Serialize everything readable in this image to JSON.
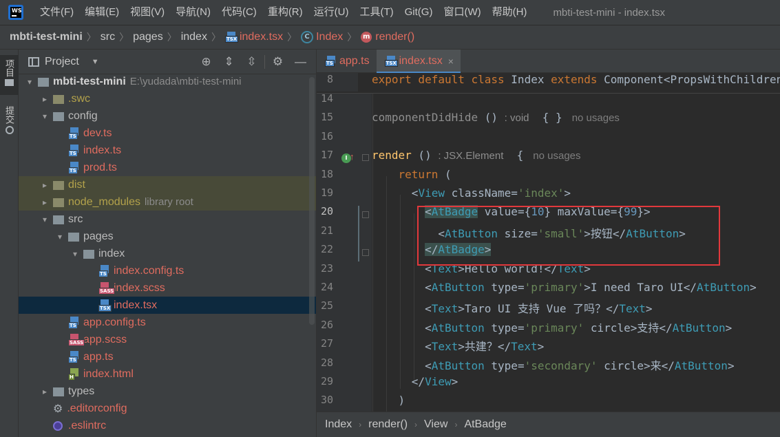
{
  "window": {
    "logo_text": "WS",
    "title": "mbti-test-mini - index.tsx"
  },
  "menu": [
    "文件(F)",
    "编辑(E)",
    "视图(V)",
    "导航(N)",
    "代码(C)",
    "重构(R)",
    "运行(U)",
    "工具(T)",
    "Git(G)",
    "窗口(W)",
    "帮助(H)"
  ],
  "breadcrumb": {
    "project": "mbti-test-mini",
    "parts": [
      "src",
      "pages",
      "index"
    ],
    "file": "index.tsx",
    "file_icon_label": "TSX",
    "class_icon": "C",
    "class": "Index",
    "method_icon": "m",
    "method": "render()"
  },
  "left_stripe": {
    "project_label": "项目",
    "commit_label": "提交"
  },
  "project_panel": {
    "title": "Project",
    "toolbar_icons": [
      "locate-icon",
      "expand-all-icon",
      "collapse-all-icon",
      "gear-icon",
      "hide-icon"
    ]
  },
  "tree": [
    {
      "name": "mbti-test-mini",
      "extra": "E:\\yudada\\mbti-test-mini",
      "kind": "folder",
      "depth": 0,
      "arrow": "▾"
    },
    {
      "name": ".swc",
      "kind": "folder",
      "depth": 1,
      "arrow": "▸",
      "color": "yellow"
    },
    {
      "name": "config",
      "kind": "folder",
      "depth": 1,
      "arrow": "▾"
    },
    {
      "name": "dev.ts",
      "kind": "ts",
      "depth": 2
    },
    {
      "name": "index.ts",
      "kind": "ts",
      "depth": 2
    },
    {
      "name": "prod.ts",
      "kind": "ts",
      "depth": 2
    },
    {
      "name": "dist",
      "kind": "folder",
      "depth": 1,
      "arrow": "▸",
      "color": "yellow",
      "excluded": true
    },
    {
      "name": "node_modules",
      "extra": "library root",
      "kind": "folder",
      "depth": 1,
      "arrow": "▸",
      "color": "yellow",
      "excluded": true
    },
    {
      "name": "src",
      "kind": "folder",
      "depth": 1,
      "arrow": "▾"
    },
    {
      "name": "pages",
      "kind": "folder",
      "depth": 2,
      "arrow": "▾"
    },
    {
      "name": "index",
      "kind": "folder",
      "depth": 3,
      "arrow": "▾"
    },
    {
      "name": "index.config.ts",
      "kind": "ts",
      "depth": 4
    },
    {
      "name": "index.scss",
      "kind": "sass",
      "depth": 4
    },
    {
      "name": "index.tsx",
      "kind": "tsx",
      "depth": 4,
      "selected": true
    },
    {
      "name": "app.config.ts",
      "kind": "ts",
      "depth": 2
    },
    {
      "name": "app.scss",
      "kind": "sass",
      "depth": 2
    },
    {
      "name": "app.ts",
      "kind": "ts",
      "depth": 2
    },
    {
      "name": "index.html",
      "kind": "html",
      "depth": 2
    },
    {
      "name": "types",
      "kind": "folder",
      "depth": 1,
      "arrow": "▸"
    },
    {
      "name": ".editorconfig",
      "kind": "config",
      "depth": 1
    },
    {
      "name": ".eslintrc",
      "kind": "eslint",
      "depth": 1
    }
  ],
  "file_icon_labels": {
    "ts": "TS",
    "tsx": "TSX",
    "sass": "SASS",
    "html": "H"
  },
  "tabs": [
    {
      "label": "app.ts",
      "icon": "TS",
      "active": false
    },
    {
      "label": "index.tsx",
      "icon": "TSX",
      "active": true,
      "close": "×"
    }
  ],
  "editor": {
    "sticky_line": {
      "num": "8",
      "tokens": [
        [
          "k",
          "export default class "
        ],
        [
          "cls",
          "Index "
        ],
        [
          "k",
          "extends "
        ],
        [
          "cls",
          "Component<PropsWithChildren>"
        ]
      ]
    },
    "lines": [
      {
        "num": "14",
        "tokens": []
      },
      {
        "num": "15",
        "tokens": [
          [
            "hint-code",
            "componentDidHide"
          ],
          [
            "cls",
            " () "
          ],
          [
            "hint",
            ": void"
          ],
          [
            "cls",
            "  { }"
          ]
        ],
        "usages": "no usages"
      },
      {
        "num": "16",
        "tokens": []
      },
      {
        "num": "17",
        "tokens": [
          [
            "fn",
            "render"
          ],
          [
            "cls",
            " () "
          ],
          [
            "hint",
            ": JSX.Element"
          ],
          [
            "cls",
            "  {"
          ]
        ],
        "usages": "no usages"
      },
      {
        "num": "18",
        "tokens": [
          [
            "sp",
            "    "
          ],
          [
            "k",
            "return"
          ],
          [
            "cls",
            " ("
          ]
        ]
      },
      {
        "num": "19",
        "tokens": [
          [
            "sp",
            "      "
          ],
          [
            "cls",
            "<"
          ],
          [
            "tag",
            "View "
          ],
          [
            "cls",
            "className="
          ],
          [
            "str",
            "'index'"
          ],
          [
            "cls",
            ">"
          ]
        ]
      },
      {
        "num": "20",
        "tokens": [
          [
            "sp",
            "        "
          ],
          [
            "cls-hl",
            "<"
          ],
          [
            "tag-hl",
            "AtBadge"
          ],
          [
            "cls",
            " value={"
          ],
          [
            "num",
            "10"
          ],
          [
            "cls",
            "} maxValue={"
          ],
          [
            "num",
            "99"
          ],
          [
            "cls",
            "}>"
          ]
        ],
        "current": true
      },
      {
        "num": "21",
        "tokens": [
          [
            "sp",
            "          "
          ],
          [
            "cls",
            "<"
          ],
          [
            "tag",
            "AtButton "
          ],
          [
            "cls",
            "size="
          ],
          [
            "str",
            "'small'"
          ],
          [
            "cls",
            ">按钮</"
          ],
          [
            "tag",
            "AtButton"
          ],
          [
            "cls",
            ">"
          ]
        ]
      },
      {
        "num": "22",
        "tokens": [
          [
            "sp",
            "        "
          ],
          [
            "cls-hl",
            "</"
          ],
          [
            "tag-hl",
            "AtBadge"
          ],
          [
            "cls-hl",
            ">"
          ]
        ]
      },
      {
        "num": "23",
        "tokens": [
          [
            "sp",
            "        "
          ],
          [
            "cls",
            "<"
          ],
          [
            "tag",
            "Text"
          ],
          [
            "cls",
            ">Hello world!</"
          ],
          [
            "tag",
            "Text"
          ],
          [
            "cls",
            ">"
          ]
        ]
      },
      {
        "num": "24",
        "tokens": [
          [
            "sp",
            "        "
          ],
          [
            "cls",
            "<"
          ],
          [
            "tag",
            "AtButton "
          ],
          [
            "cls",
            "type="
          ],
          [
            "str",
            "'primary'"
          ],
          [
            "cls",
            ">I need Taro UI</"
          ],
          [
            "tag",
            "AtButton"
          ],
          [
            "cls",
            ">"
          ]
        ]
      },
      {
        "num": "25",
        "tokens": [
          [
            "sp",
            "        "
          ],
          [
            "cls",
            "<"
          ],
          [
            "tag",
            "Text"
          ],
          [
            "cls",
            ">Taro UI 支持 Vue 了吗？</"
          ],
          [
            "tag",
            "Text"
          ],
          [
            "cls",
            ">"
          ]
        ]
      },
      {
        "num": "26",
        "tokens": [
          [
            "sp",
            "        "
          ],
          [
            "cls",
            "<"
          ],
          [
            "tag",
            "AtButton "
          ],
          [
            "cls",
            "type="
          ],
          [
            "str",
            "'primary' "
          ],
          [
            "cls",
            "circle>支持</"
          ],
          [
            "tag",
            "AtButton"
          ],
          [
            "cls",
            ">"
          ]
        ]
      },
      {
        "num": "27",
        "tokens": [
          [
            "sp",
            "        "
          ],
          [
            "cls",
            "<"
          ],
          [
            "tag",
            "Text"
          ],
          [
            "cls",
            ">共建？</"
          ],
          [
            "tag",
            "Text"
          ],
          [
            "cls",
            ">"
          ]
        ]
      },
      {
        "num": "28",
        "tokens": [
          [
            "sp",
            "        "
          ],
          [
            "cls",
            "<"
          ],
          [
            "tag",
            "AtButton "
          ],
          [
            "cls",
            "type="
          ],
          [
            "str",
            "'secondary' "
          ],
          [
            "cls",
            "circle>来</"
          ],
          [
            "tag",
            "AtButton"
          ],
          [
            "cls",
            ">"
          ]
        ]
      },
      {
        "num": "29",
        "tokens": [
          [
            "sp",
            "      "
          ],
          [
            "cls",
            "</"
          ],
          [
            "tag",
            "View"
          ],
          [
            "cls",
            ">"
          ]
        ]
      },
      {
        "num": "30",
        "tokens": [
          [
            "sp",
            "    "
          ],
          [
            "cls",
            ")"
          ]
        ]
      }
    ]
  },
  "editor_breadcrumb": [
    "Index",
    "render()",
    "View",
    "AtBadge"
  ],
  "colors": {
    "accent": "#4a88c7",
    "highlight_border": "#e2383c",
    "file_modified": "#e06c5f"
  }
}
